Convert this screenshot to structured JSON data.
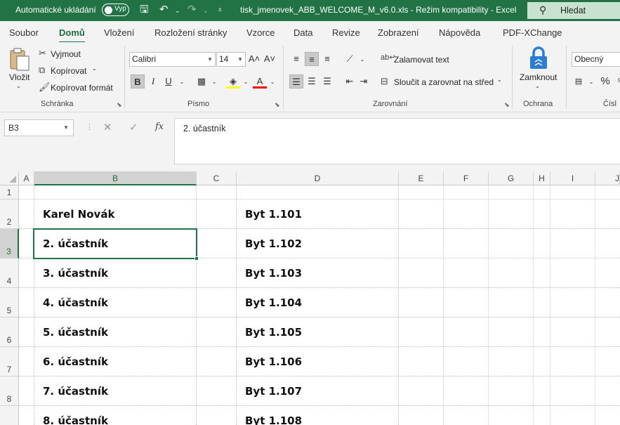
{
  "titlebar": {
    "autosave_label": "Automatické ukládání",
    "autosave_state": "Vyp",
    "document_title": "tisk_jmenovek_ABB_WELCOME_M_v6.0.xls  -  Režim kompatibility  -  Excel",
    "search_label": "Hledat",
    "accent_color": "#217346"
  },
  "menu": {
    "tabs": [
      "Soubor",
      "Domů",
      "Vložení",
      "Rozložení stránky",
      "Vzorce",
      "Data",
      "Revize",
      "Zobrazení",
      "Nápověda",
      "PDF-XChange"
    ],
    "active": "Domů"
  },
  "ribbon": {
    "clipboard": {
      "paste": "Vložit",
      "cut": "Vyjmout",
      "copy": "Kopírovat",
      "format_painter": "Kopírovat formát",
      "group": "Schránka"
    },
    "font": {
      "font_name": "Calibri",
      "font_size": "14",
      "bold": "B",
      "italic": "I",
      "underline": "U",
      "group": "Písmo"
    },
    "alignment": {
      "wrap_text": "Zalamovat text",
      "merge_center": "Sloučit a zarovnat na střed",
      "group": "Zarovnání"
    },
    "protection": {
      "lock": "Zamknout",
      "group": "Ochrana"
    },
    "number": {
      "format": "Obecný",
      "percent": "%",
      "group": "Čísl"
    }
  },
  "formula_bar": {
    "name_box": "B3",
    "fx": "fx",
    "content": "2. účastník"
  },
  "sheet": {
    "columns": [
      "A",
      "B",
      "C",
      "D",
      "E",
      "F",
      "G",
      "H",
      "I",
      "J"
    ],
    "rows": [
      "1",
      "2",
      "3",
      "4",
      "5",
      "6",
      "7",
      "8"
    ],
    "selected_column": "B",
    "selected_row": "3",
    "cells": {
      "B2": "Karel Novák",
      "D2": "Byt 1.101",
      "B3": "2. účastník",
      "D3": "Byt 1.102",
      "B4": "3. účastník",
      "D4": "Byt 1.103",
      "B5": "4. účastník",
      "D5": "Byt 1.104",
      "B6": "5. účastník",
      "D6": "Byt 1.105",
      "B7": "6. účastník",
      "D7": "Byt 1.106",
      "B8": "7. účastník",
      "D8": "Byt 1.107",
      "B9": "8. účastník",
      "D9": "Byt 1.108"
    }
  }
}
